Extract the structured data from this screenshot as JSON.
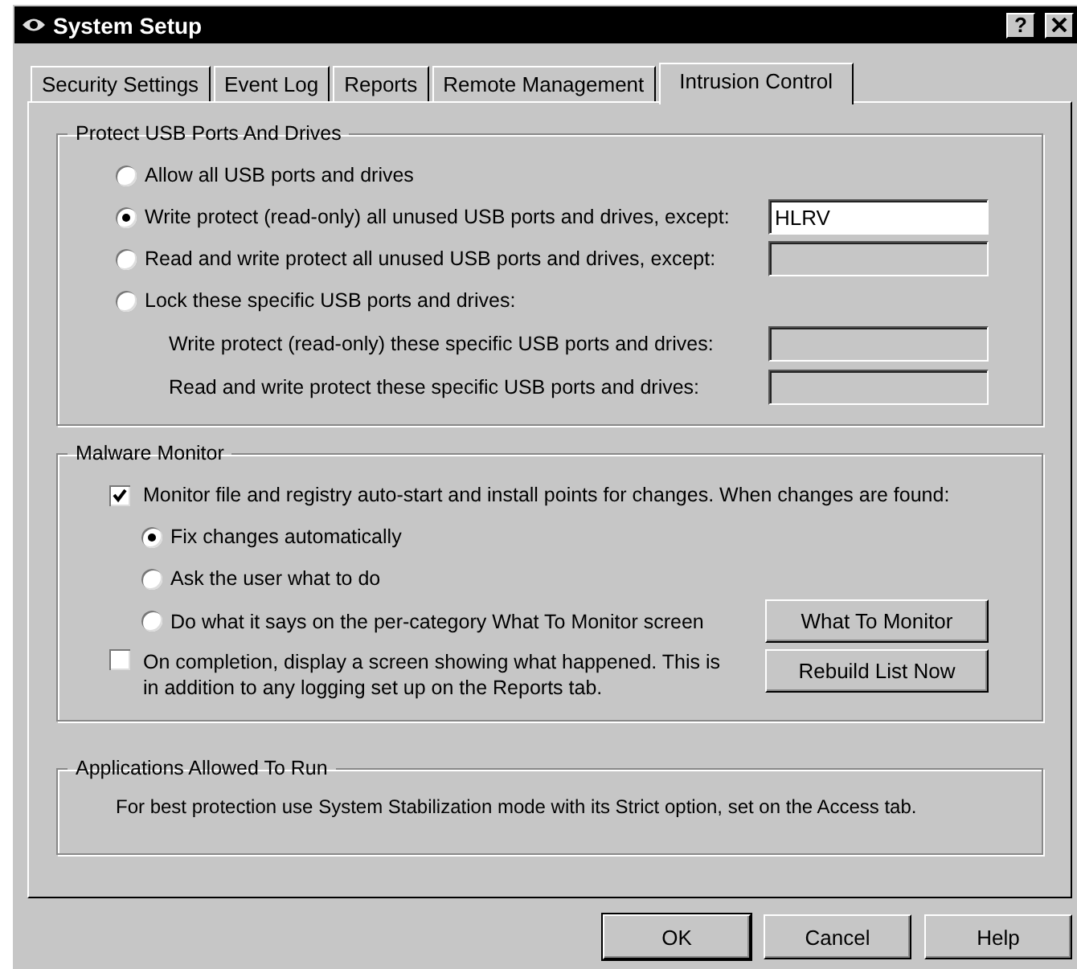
{
  "window": {
    "title": "System Setup",
    "help_button": "?"
  },
  "tabs": [
    {
      "label": "Security Settings",
      "selected": false
    },
    {
      "label": "Event Log",
      "selected": false
    },
    {
      "label": "Reports",
      "selected": false
    },
    {
      "label": "Remote Management",
      "selected": false
    },
    {
      "label": "Intrusion Control",
      "selected": true
    }
  ],
  "usb_group": {
    "title": "Protect USB Ports And Drives",
    "options": [
      {
        "label": "Allow all USB ports and drives",
        "selected": false
      },
      {
        "label": "Write protect (read-only) all unused USB ports and drives, except:",
        "selected": true,
        "field": {
          "value": "HLRV",
          "disabled": false
        }
      },
      {
        "label": "Read and write protect all unused USB ports and drives, except:",
        "selected": false,
        "field": {
          "disabled": true
        }
      },
      {
        "label": "Lock these specific USB ports and drives:",
        "selected": false,
        "children": [
          {
            "label": "Write protect (read-only) these specific USB ports and drives:",
            "field": {
              "disabled": true
            }
          },
          {
            "label": "Read and write protect these specific USB ports and drives:",
            "field": {
              "disabled": true
            }
          }
        ]
      }
    ]
  },
  "malware_group": {
    "title": "Malware Monitor",
    "monitor_checkbox": {
      "label": "Monitor file and registry auto-start and install points for changes.  When changes are found:",
      "checked": true
    },
    "options": [
      {
        "label": "Fix changes automatically",
        "selected": true
      },
      {
        "label": "Ask the user what to do",
        "selected": false
      },
      {
        "label": "Do what it says on the per-category What To Monitor screen",
        "selected": false,
        "button": "What To Monitor"
      }
    ],
    "completion_checkbox": {
      "label": "On completion, display a screen showing what happened.  This is in addition to any logging set up on the Reports tab.",
      "checked": false,
      "button": "Rebuild List Now"
    }
  },
  "apps_group": {
    "title": "Applications Allowed To Run",
    "text": "For best protection use System Stabilization mode with its Strict option, set on the Access tab."
  },
  "buttons": [
    {
      "label": "OK",
      "default": true
    },
    {
      "label": "Cancel",
      "default": false
    },
    {
      "label": "Help",
      "default": false
    }
  ]
}
